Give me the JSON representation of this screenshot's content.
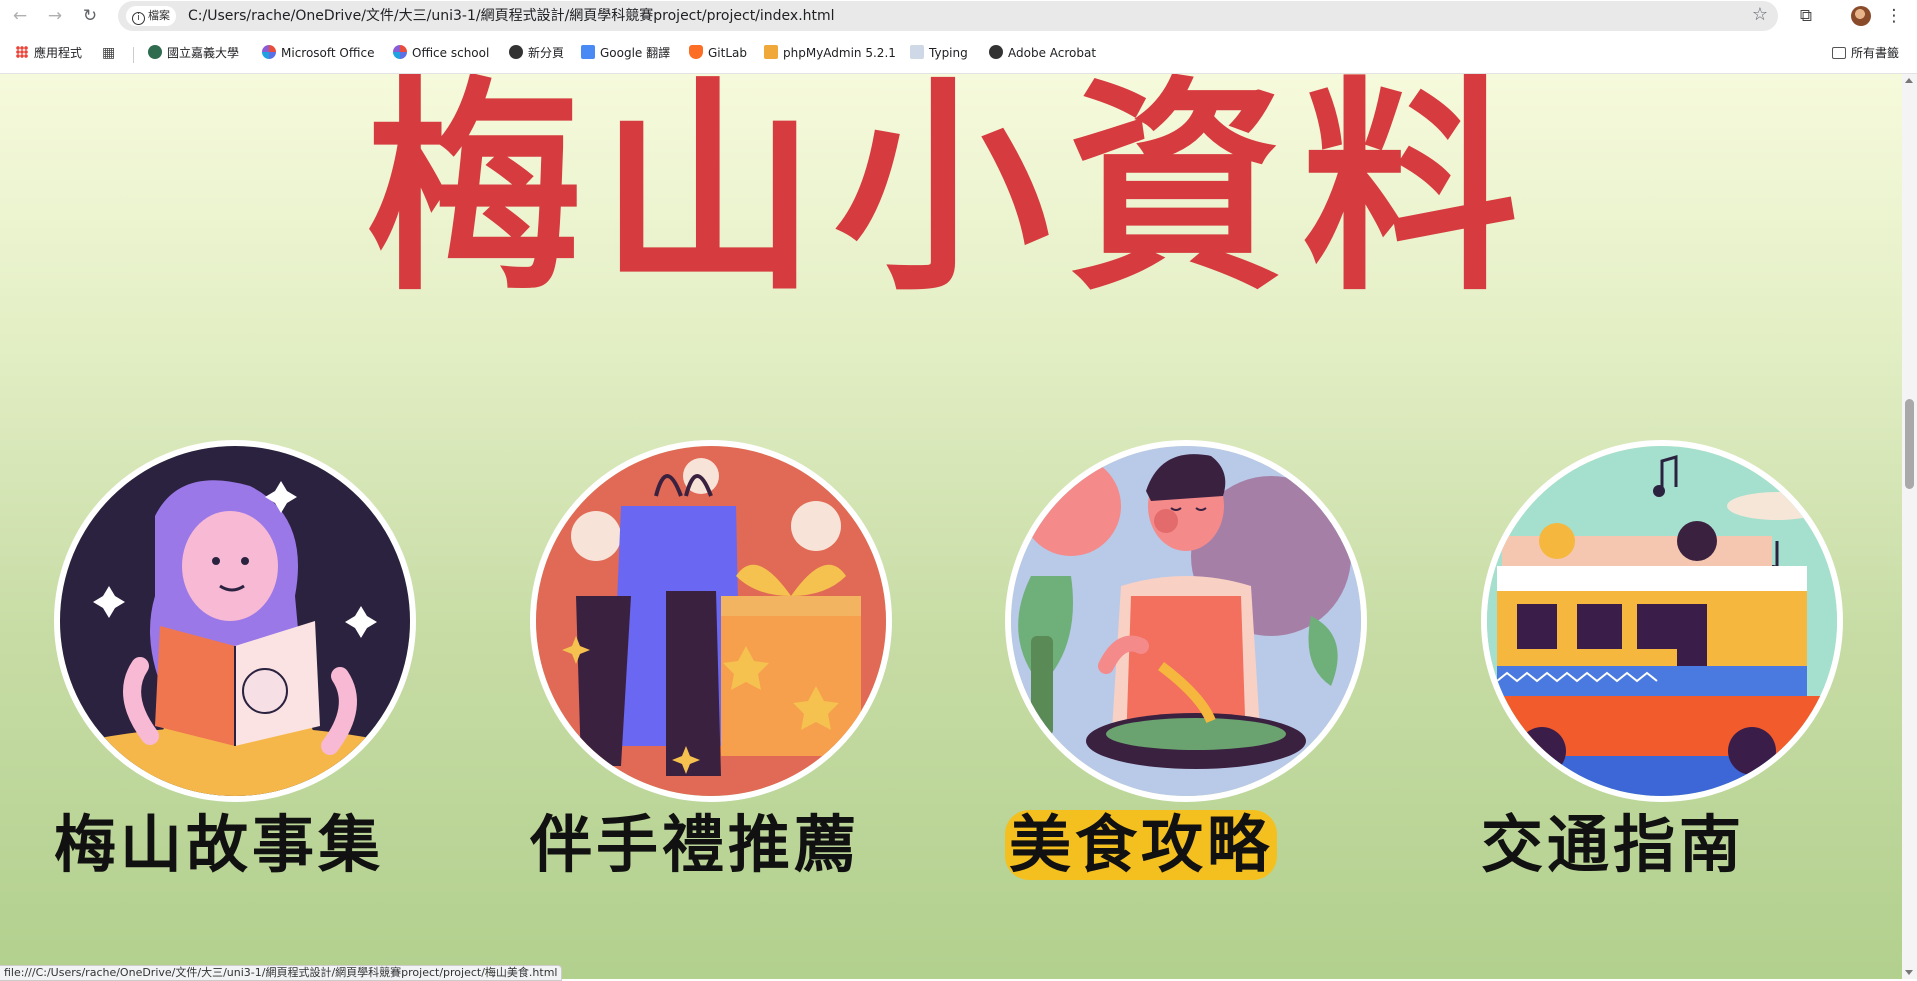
{
  "browser": {
    "site_info_label": "檔案",
    "url": "C:/Users/rache/OneDrive/文件/大三/uni3-1/網頁程式設計/網頁學科競賽project/project/index.html",
    "status_url": "file:///C:/Users/rache/OneDrive/文件/大三/uni3-1/網頁程式設計/網頁學科競賽project/project/梅山美食.html"
  },
  "bookmarks": {
    "items": [
      {
        "label": "應用程式",
        "icon": "apps-grid-icon"
      },
      {
        "label": "國立嘉義大學",
        "icon": "university-logo-icon"
      },
      {
        "label": "Microsoft Office",
        "icon": "office-icon"
      },
      {
        "label": "Office school",
        "icon": "office-icon"
      },
      {
        "label": "新分頁",
        "icon": "globe-icon"
      },
      {
        "label": "Google 翻譯",
        "icon": "translate-icon"
      },
      {
        "label": "GitLab",
        "icon": "gitlab-icon"
      },
      {
        "label": "phpMyAdmin 5.2.1",
        "icon": "phpmyadmin-icon"
      },
      {
        "label": "Typing",
        "icon": "typing-icon"
      },
      {
        "label": "Adobe Acrobat",
        "icon": "globe-icon"
      }
    ],
    "all_bookmarks": "所有書籤"
  },
  "page": {
    "title": "梅山小資料",
    "cards": [
      {
        "label": "梅山故事集",
        "icon": "reading-girl-illustration"
      },
      {
        "label": "伴手禮推薦",
        "icon": "gift-bags-illustration"
      },
      {
        "label": "美食攻略",
        "icon": "cooking-chef-illustration"
      },
      {
        "label": "交通指南",
        "icon": "bus-illustration"
      }
    ]
  },
  "colors": {
    "title": "#d63c3f",
    "highlight": "#f4c020",
    "bg_top": "#f6fadc",
    "bg_bottom": "#b2d08e"
  }
}
